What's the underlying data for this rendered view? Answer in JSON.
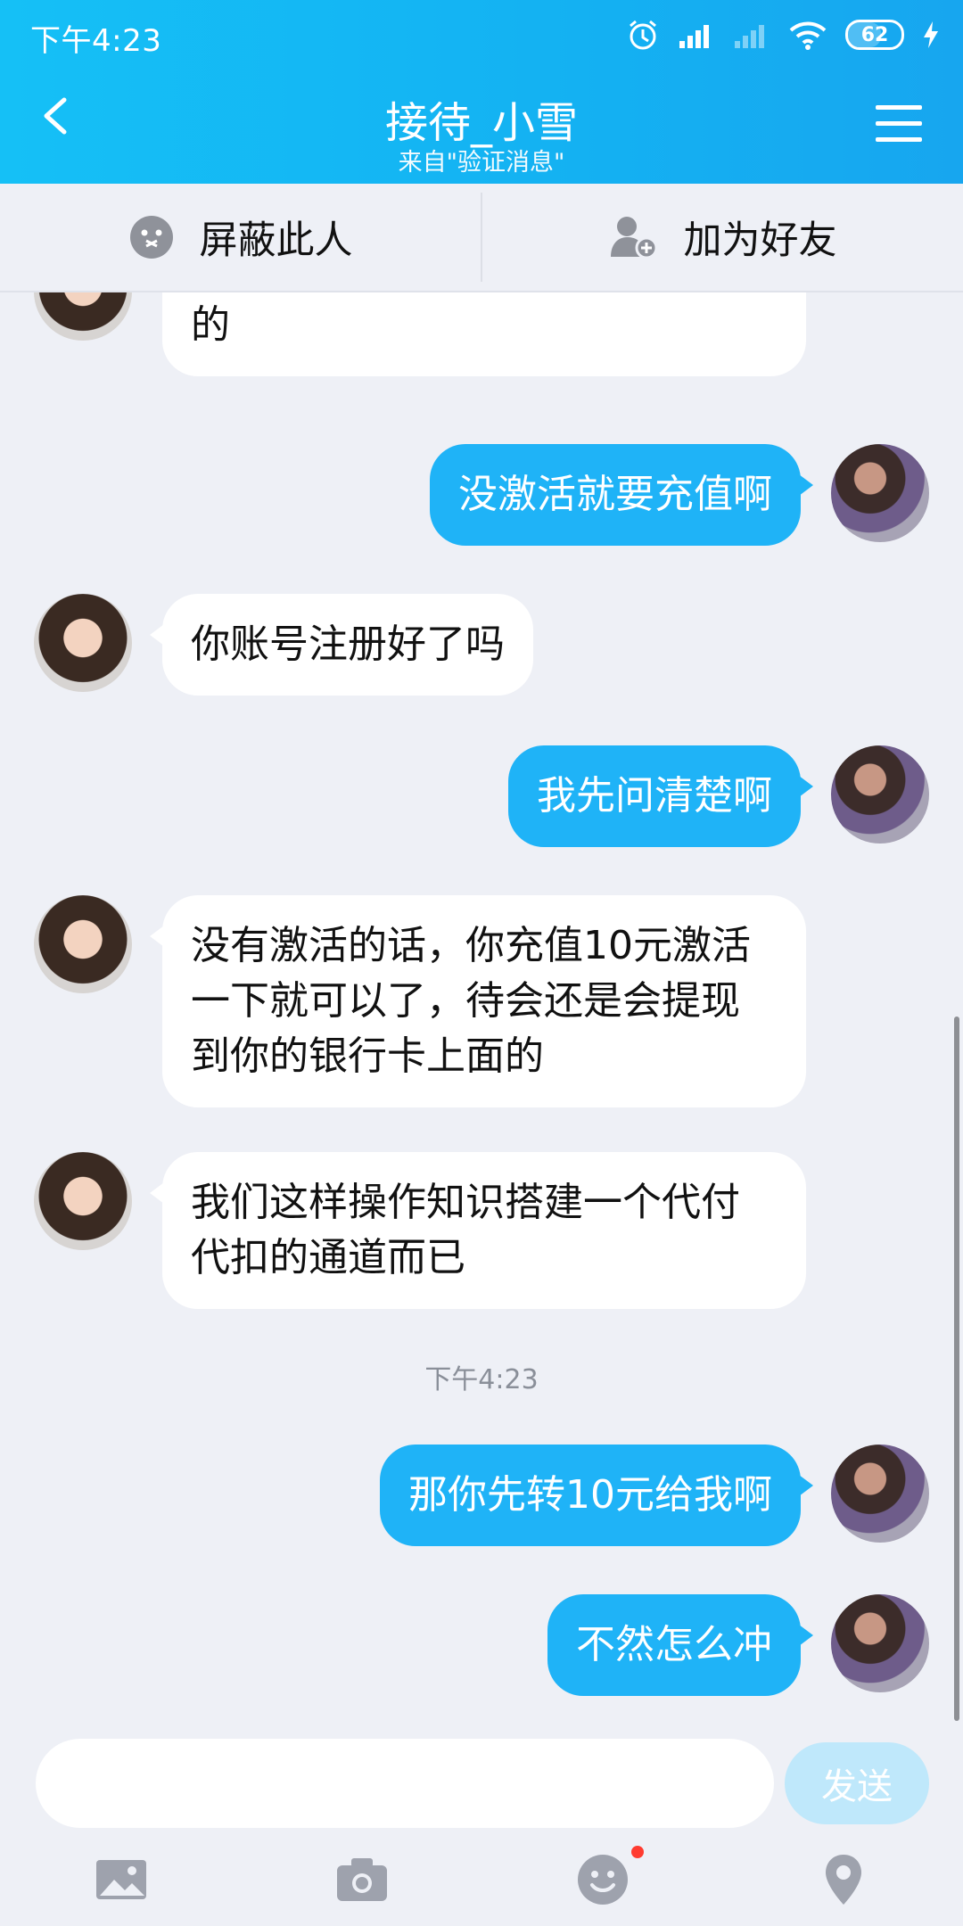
{
  "status": {
    "time": "下午4:23",
    "battery": "62"
  },
  "header": {
    "title": "接待_小雪",
    "subtitle": "来自\"验证消息\""
  },
  "actions": {
    "block": "屏蔽此人",
    "add_friend": "加为好友"
  },
  "messages": [
    {
      "from": "her",
      "text": "要是已经激活额度是不需要充值的"
    },
    {
      "from": "me",
      "text": "没激活就要充值啊"
    },
    {
      "from": "her",
      "text": "你账号注册好了吗"
    },
    {
      "from": "me",
      "text": "我先问清楚啊"
    },
    {
      "from": "her",
      "text": "没有激活的话，你充值10元激活一下就可以了，待会还是会提现到你的银行卡上面的"
    },
    {
      "from": "her",
      "text": "我们这样操作知识搭建一个代付代扣的通道而已"
    },
    {
      "from": "time",
      "text": "下午4:23"
    },
    {
      "from": "me",
      "text": "那你先转10元给我啊"
    },
    {
      "from": "me",
      "text": "不然怎么冲"
    }
  ],
  "composer": {
    "placeholder": "",
    "send_label": "发送"
  },
  "toolbar": [
    "image-icon",
    "camera-icon",
    "emoji-icon",
    "location-icon"
  ],
  "colors": {
    "header": "#14b1f2",
    "bubble_out": "#1fb3f7",
    "bubble_in": "#ffffff",
    "badge": "#ff3b30"
  }
}
